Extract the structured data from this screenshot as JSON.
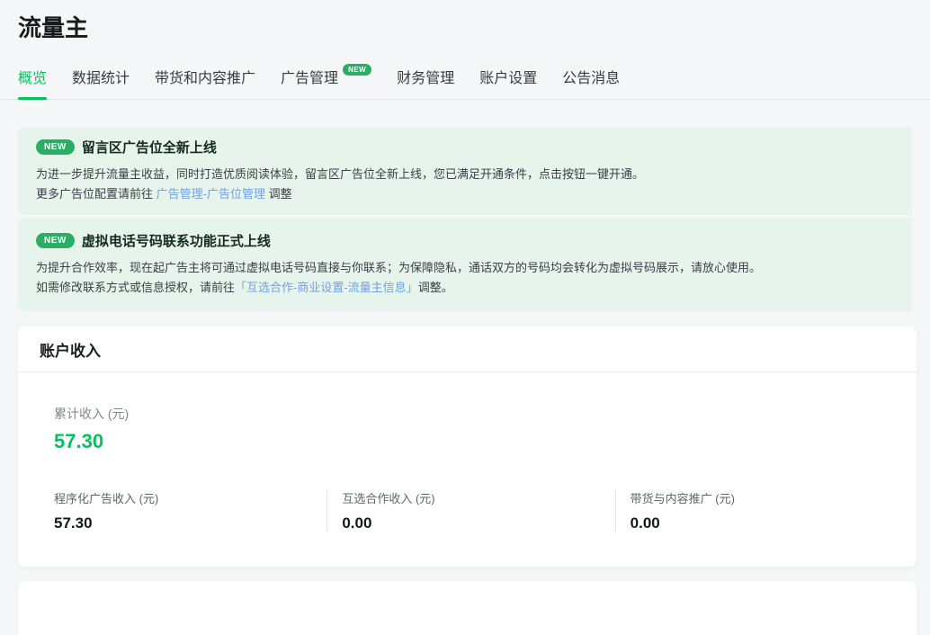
{
  "page": {
    "title": "流量主",
    "accent_color": "#07c160",
    "link_color": "#71a3dc",
    "banner_bg": "#e6f4ec"
  },
  "tabs": [
    {
      "label": "概览",
      "active": true
    },
    {
      "label": "数据统计",
      "active": false
    },
    {
      "label": "带货和内容推广",
      "active": false
    },
    {
      "label": "广告管理",
      "active": false,
      "badge": "NEW"
    },
    {
      "label": "财务管理",
      "active": false
    },
    {
      "label": "账户设置",
      "active": false
    },
    {
      "label": "公告消息",
      "active": false
    }
  ],
  "banners": [
    {
      "badge": "NEW",
      "title": "留言区广告位全新上线",
      "line1": "为进一步提升流量主收益，同时打造优质阅读体验，留言区广告位全新上线，您已满足开通条件，点击按钮一键开通。",
      "line2_prefix": "更多广告位配置请前往 ",
      "line2_link": "广告管理-广告位管理",
      "line2_suffix": " 调整"
    },
    {
      "badge": "NEW",
      "title": "虚拟电话号码联系功能正式上线",
      "line1": "为提升合作效率，现在起广告主将可通过虚拟电话号码直接与你联系；为保障隐私，通话双方的号码均会转化为虚拟号码展示，请放心使用。",
      "line2_prefix": "如需修改联系方式或信息授权，请前往",
      "line2_link": "「互选合作-商业设置-流量主信息」",
      "line2_suffix": "调整。"
    }
  ],
  "income_card": {
    "title": "账户收入",
    "total": {
      "label": "累计收入 (元)",
      "value": "57.30"
    },
    "columns": [
      {
        "label": "程序化广告收入 (元)",
        "value": "57.30"
      },
      {
        "label": "互选合作收入 (元)",
        "value": "0.00"
      },
      {
        "label": "带货与内容推广 (元)",
        "value": "0.00"
      }
    ]
  }
}
